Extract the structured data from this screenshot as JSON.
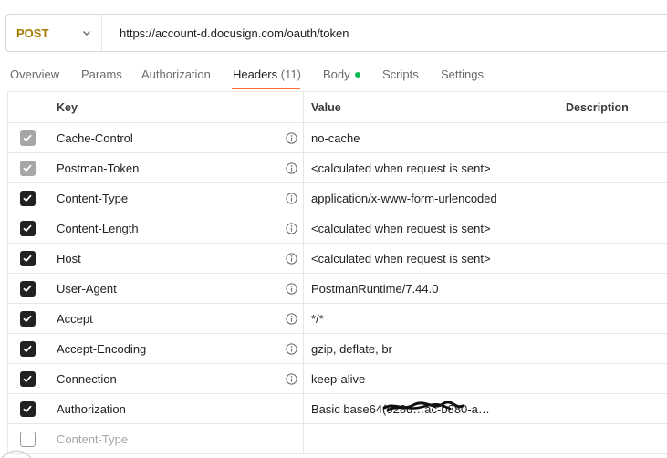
{
  "request": {
    "method": "POST",
    "url": "https://account-d.docusign.com/oauth/token"
  },
  "tabs": [
    {
      "label": "Overview"
    },
    {
      "label": "Params"
    },
    {
      "label": "Authorization"
    },
    {
      "label": "Headers",
      "count": "(11)"
    },
    {
      "label": "Body"
    },
    {
      "label": "Scripts"
    },
    {
      "label": "Settings"
    }
  ],
  "columns": {
    "key": "Key",
    "value": "Value",
    "description": "Description"
  },
  "rows": [
    {
      "key": "Cache-Control",
      "value": "no-cache",
      "state": "checked-disabled"
    },
    {
      "key": "Postman-Token",
      "value": "<calculated when request is sent>",
      "state": "checked-disabled"
    },
    {
      "key": "Content-Type",
      "value": "application/x-www-form-urlencoded",
      "state": "checked"
    },
    {
      "key": "Content-Length",
      "value": "<calculated when request is sent>",
      "state": "checked"
    },
    {
      "key": "Host",
      "value": "<calculated when request is sent>",
      "state": "checked"
    },
    {
      "key": "User-Agent",
      "value": "PostmanRuntime/7.44.0",
      "state": "checked"
    },
    {
      "key": "Accept",
      "value": "*/*",
      "state": "checked"
    },
    {
      "key": "Accept-Encoding",
      "value": "gzip, deflate, br",
      "state": "checked"
    },
    {
      "key": "Connection",
      "value": "keep-alive",
      "state": "checked"
    },
    {
      "key": "Authorization",
      "value": "Basic base64(828d…ac-b880-a…",
      "state": "checked"
    },
    {
      "key": "",
      "placeholder": "Content-Type",
      "value": "",
      "state": "unchecked"
    }
  ],
  "colors": {
    "method": "#a57a00",
    "active_tab_underline": "#ff6c37",
    "body_dot": "#0cbb52"
  }
}
